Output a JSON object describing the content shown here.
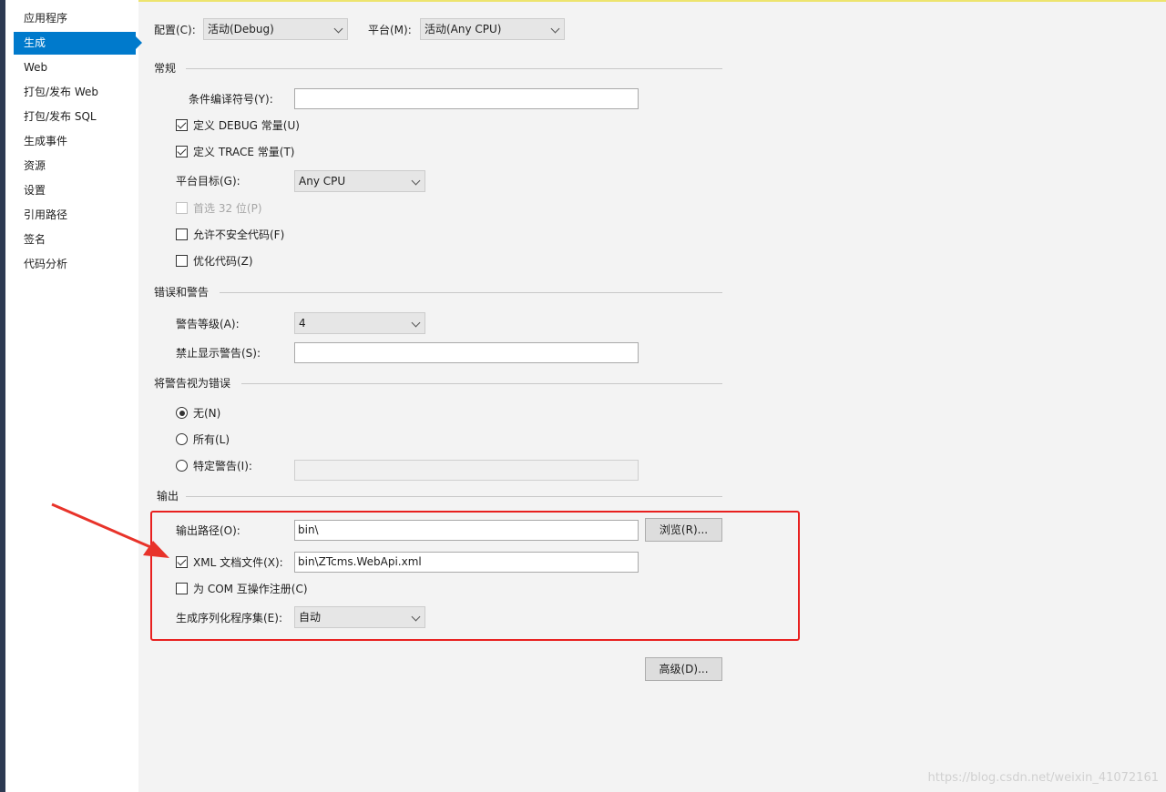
{
  "sidebar": {
    "items": [
      {
        "label": "应用程序"
      },
      {
        "label": "生成",
        "active": true
      },
      {
        "label": "Web"
      },
      {
        "label": "打包/发布 Web"
      },
      {
        "label": "打包/发布 SQL"
      },
      {
        "label": "生成事件"
      },
      {
        "label": "资源"
      },
      {
        "label": "设置"
      },
      {
        "label": "引用路径"
      },
      {
        "label": "签名"
      },
      {
        "label": "代码分析"
      }
    ]
  },
  "top": {
    "config_label": "配置(C):",
    "config_value": "活动(Debug)",
    "platform_label": "平台(M):",
    "platform_value": "活动(Any CPU)"
  },
  "general": {
    "title": "常规",
    "conditional_symbols_label": "条件编译符号(Y):",
    "conditional_symbols_value": "",
    "define_debug_label": "定义 DEBUG 常量(U)",
    "define_debug_checked": true,
    "define_trace_label": "定义 TRACE 常量(T)",
    "define_trace_checked": true,
    "platform_target_label": "平台目标(G):",
    "platform_target_value": "Any CPU",
    "prefer32_label": "首选 32 位(P)",
    "prefer32_checked": false,
    "unsafe_label": "允许不安全代码(F)",
    "unsafe_checked": false,
    "optimize_label": "优化代码(Z)",
    "optimize_checked": false
  },
  "errors": {
    "title": "错误和警告",
    "warning_level_label": "警告等级(A):",
    "warning_level_value": "4",
    "suppress_label": "禁止显示警告(S):",
    "suppress_value": ""
  },
  "treat_warnings": {
    "title": "将警告视为错误",
    "none_label": "无(N)",
    "all_label": "所有(L)",
    "specific_label": "特定警告(I):",
    "specific_value": "",
    "selected": "none"
  },
  "output": {
    "title": "输出",
    "path_label": "输出路径(O):",
    "path_value": "bin\\",
    "browse_label": "浏览(R)...",
    "xml_doc_label": "XML 文档文件(X):",
    "xml_doc_checked": true,
    "xml_doc_value": "bin\\ZTcms.WebApi.xml",
    "com_interop_label": "为 COM 互操作注册(C)",
    "com_interop_checked": false,
    "serialization_label": "生成序列化程序集(E):",
    "serialization_value": "自动"
  },
  "advanced_label": "高级(D)...",
  "watermark": "https://blog.csdn.net/weixin_41072161",
  "colors": {
    "accent": "#007acc",
    "highlight": "#e8201f",
    "arrow": "#e8332a"
  }
}
